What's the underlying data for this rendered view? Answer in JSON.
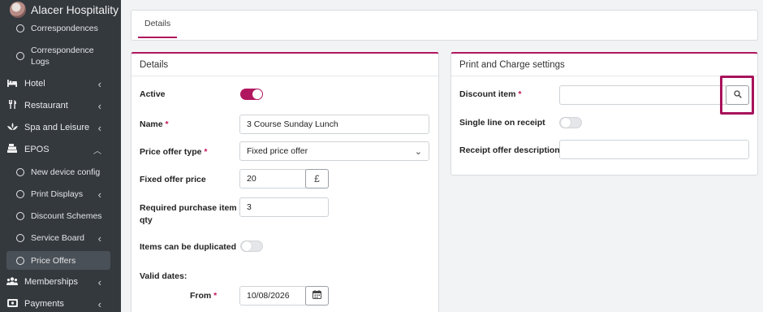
{
  "app": {
    "brand": "Alacer Hospitality"
  },
  "sidebar": {
    "items": [
      {
        "label": "Correspondences",
        "type": "sub"
      },
      {
        "label": "Correspondence Logs",
        "type": "sub"
      },
      {
        "label": "Hotel",
        "type": "main",
        "icon": "bed-icon"
      },
      {
        "label": "Restaurant",
        "type": "main",
        "icon": "utensils-icon"
      },
      {
        "label": "Spa and Leisure",
        "type": "main",
        "icon": "spa-icon"
      },
      {
        "label": "EPOS",
        "type": "main",
        "icon": "register-icon",
        "expanded": true
      },
      {
        "label": "New device config",
        "type": "sub"
      },
      {
        "label": "Print Displays",
        "type": "sub"
      },
      {
        "label": "Discount Schemes",
        "type": "sub"
      },
      {
        "label": "Service Board",
        "type": "sub"
      },
      {
        "label": "Price Offers",
        "type": "sub",
        "active": true
      },
      {
        "label": "Memberships",
        "type": "main",
        "icon": "users-icon"
      },
      {
        "label": "Payments",
        "type": "main",
        "icon": "payment-icon"
      }
    ]
  },
  "tabs": {
    "details": "Details"
  },
  "details": {
    "title": "Details",
    "active_label": "Active",
    "active_on": true,
    "name_label": "Name",
    "name_value": "3 Course Sunday Lunch",
    "type_label": "Price offer type",
    "type_value": "Fixed price offer",
    "fixed_label": "Fixed offer price",
    "fixed_value": "20",
    "currency": "£",
    "req_qty_label_1": "Required purchase item",
    "req_qty_label_2": "qty",
    "req_qty_value": "3",
    "dup_label": "Items can be duplicated",
    "dup_on": false,
    "valid_label": "Valid dates:",
    "from_label": "From",
    "from_value": "10/08/2026",
    "required_mark": "*"
  },
  "print": {
    "title": "Print and Charge settings",
    "discount_label": "Discount item",
    "discount_value": "",
    "single_label": "Single line on receipt",
    "single_on": false,
    "receipt_label": "Receipt offer description",
    "receipt_value": ""
  },
  "colors": {
    "accent": "#b0175f",
    "sidebar": "#34393e"
  }
}
